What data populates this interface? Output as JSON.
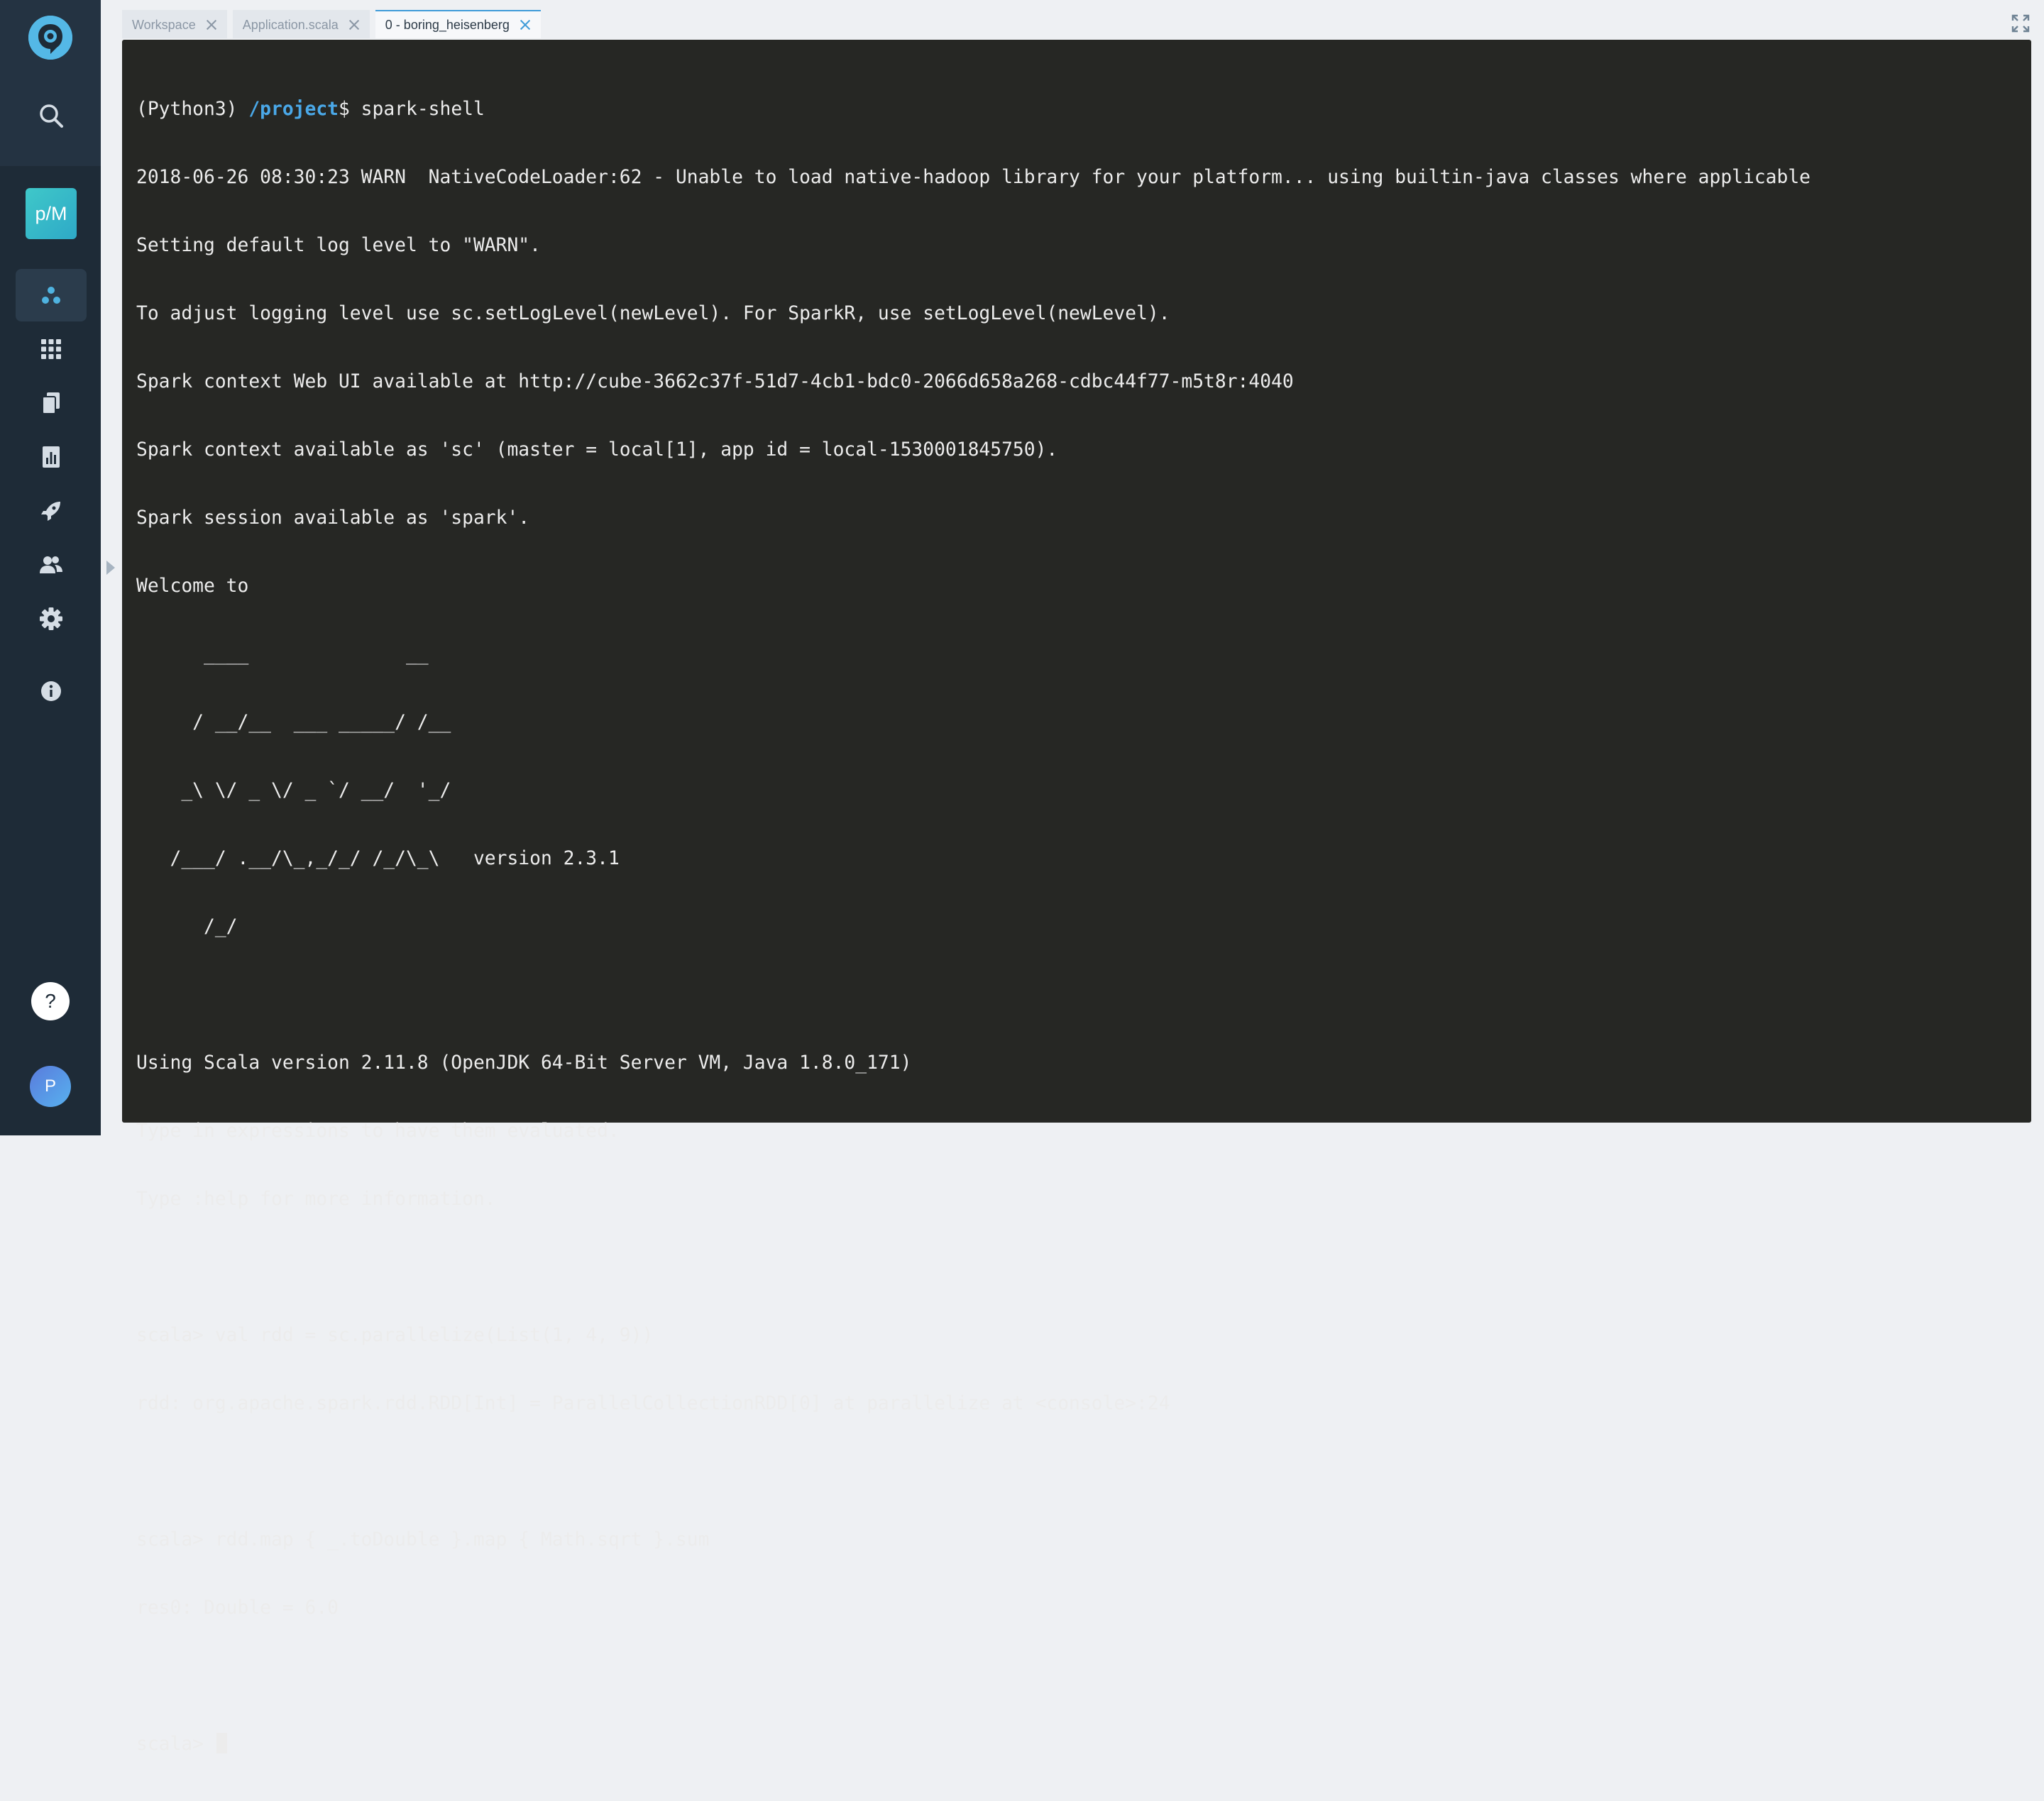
{
  "sidebar": {
    "logo_icon": "app-logo-icon",
    "project_badge": "p/M",
    "nav_items": [
      {
        "name": "search-icon"
      },
      {
        "name": "workspace-icon",
        "active": true
      },
      {
        "name": "apps-grid-icon"
      },
      {
        "name": "documents-icon"
      },
      {
        "name": "reports-icon"
      },
      {
        "name": "deploy-rocket-icon"
      },
      {
        "name": "users-icon"
      },
      {
        "name": "settings-gear-icon"
      },
      {
        "name": "info-icon"
      }
    ],
    "help_label": "?",
    "avatar_initial": "P"
  },
  "tabs": [
    {
      "label": "Workspace",
      "active": false
    },
    {
      "label": "Application.scala",
      "active": false
    },
    {
      "label": "0 - boring_heisenberg",
      "active": true
    }
  ],
  "terminal": {
    "prompt_prefix": "(Python3) ",
    "prompt_path": "/project",
    "prompt_suffix": "$ spark-shell",
    "lines": [
      "2018-06-26 08:30:23 WARN  NativeCodeLoader:62 - Unable to load native-hadoop library for your platform... using builtin-java classes where applicable",
      "Setting default log level to \"WARN\".",
      "To adjust logging level use sc.setLogLevel(newLevel). For SparkR, use setLogLevel(newLevel).",
      "Spark context Web UI available at http://cube-3662c37f-51d7-4cb1-bdc0-2066d658a268-cdbc44f77-m5t8r:4040",
      "Spark context available as 'sc' (master = local[1], app id = local-1530001845750).",
      "Spark session available as 'spark'.",
      "Welcome to",
      "      ____              __",
      "     / __/__  ___ _____/ /__",
      "    _\\ \\/ _ \\/ _ `/ __/  '_/",
      "   /___/ .__/\\_,_/_/ /_/\\_\\   version 2.3.1",
      "      /_/",
      "",
      "Using Scala version 2.11.8 (OpenJDK 64-Bit Server VM, Java 1.8.0_171)",
      "Type in expressions to have them evaluated.",
      "Type :help for more information.",
      "",
      "scala> val rdd = sc.parallelize(List(1, 4, 9))",
      "rdd: org.apache.spark.rdd.RDD[Int] = ParallelCollectionRDD[0] at parallelize at <console>:24",
      "",
      "scala> rdd.map { _.toDouble }.map { Math.sqrt }.sum",
      "res0: Double = 6.0",
      ""
    ],
    "current_prompt": "scala> "
  },
  "colors": {
    "sidebar_bg": "#1e2b37",
    "terminal_bg": "#262724",
    "accent": "#3f9bd8",
    "path_color": "#4aa8e8"
  }
}
